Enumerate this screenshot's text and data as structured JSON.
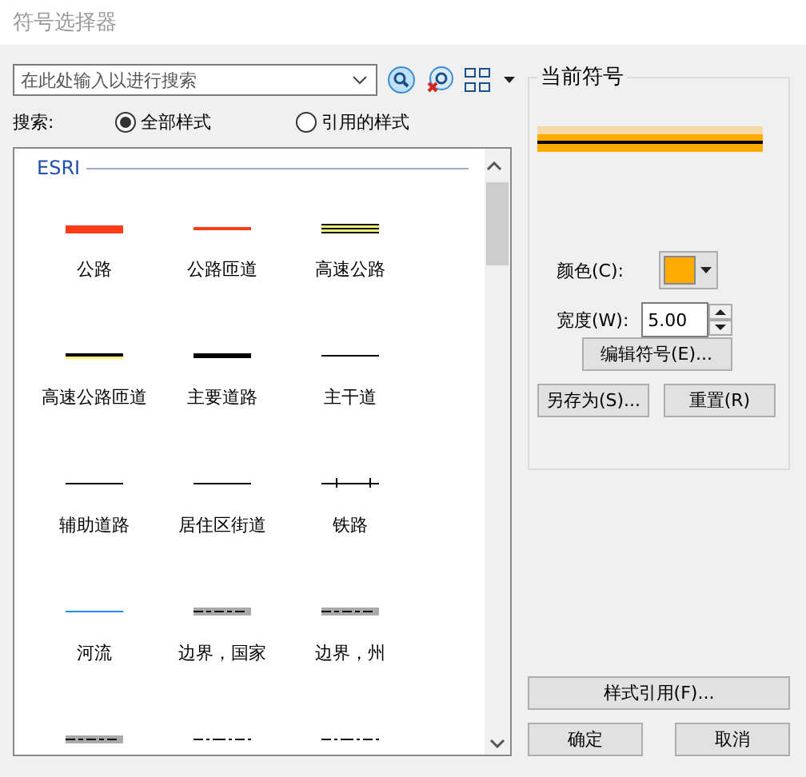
{
  "window": {
    "title": "符号选择器"
  },
  "search": {
    "placeholder": "在此处输入以进行搜索"
  },
  "scope": {
    "label": "搜索:",
    "options": [
      {
        "label": "全部样式",
        "selected": true
      },
      {
        "label": "引用的样式",
        "selected": false
      }
    ]
  },
  "gallery": {
    "group": "ESRI",
    "symbols": [
      {
        "label": "公路",
        "kind": "thick-red"
      },
      {
        "label": "公路匝道",
        "kind": "thin-red"
      },
      {
        "label": "高速公路",
        "kind": "triple"
      },
      {
        "label": "高速公路匝道",
        "kind": "yellow-cased"
      },
      {
        "label": "主要道路",
        "kind": "thick-black"
      },
      {
        "label": "主干道",
        "kind": "plain"
      },
      {
        "label": "辅助道路",
        "kind": "plain"
      },
      {
        "label": "居住区街道",
        "kind": "plain"
      },
      {
        "label": "铁路",
        "kind": "rail"
      },
      {
        "label": "河流",
        "kind": "blue"
      },
      {
        "label": "边界，国家",
        "kind": "border-gray"
      },
      {
        "label": "边界，州",
        "kind": "border-gray"
      },
      {
        "kind": "border-gray"
      },
      {
        "kind": "dashdot"
      },
      {
        "kind": "dashdot"
      }
    ]
  },
  "current_symbol": {
    "title": "当前符号",
    "color_label": "颜色(C):",
    "color": "#ffaa00",
    "width_label": "宽度(W):",
    "width_value": "5.00",
    "edit_button": "编辑符号(E)...",
    "save_as_button": "另存为(S)...",
    "reset_button": "重置(R)"
  },
  "style_refs_button": "样式引用(F)...",
  "buttons": [
    "确定",
    "取消"
  ]
}
